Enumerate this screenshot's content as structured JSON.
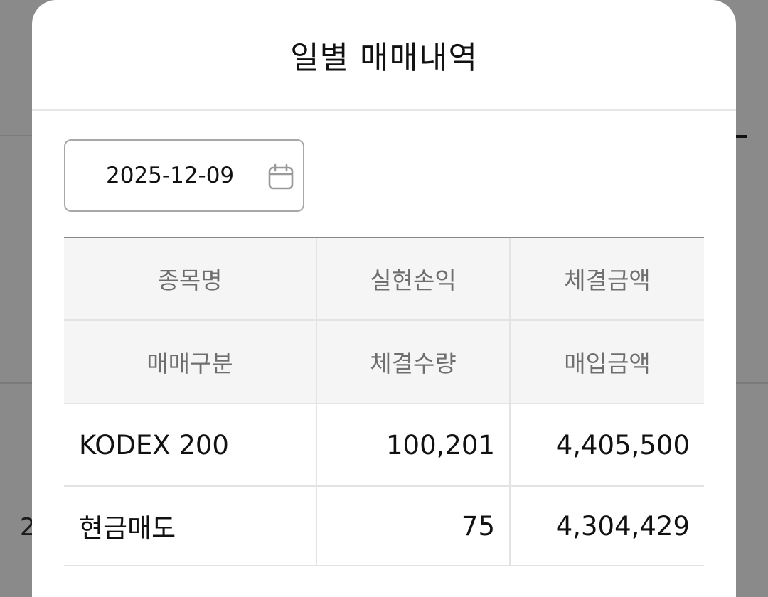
{
  "modal": {
    "title": "일별 매매내역"
  },
  "date_filter": {
    "value": "2025-12-09",
    "icon": "calendar-icon"
  },
  "table": {
    "headers_row1": [
      "종목명",
      "실현손익",
      "체결금액"
    ],
    "headers_row2": [
      "매매구분",
      "체결수량",
      "매입금액"
    ],
    "rows": [
      {
        "name": "KODEX 200",
        "realized_pnl": "100,201",
        "trade_amount": "4,405,500",
        "trade_type": "현금매도",
        "quantity": "75",
        "purchase_amount": "4,304,429"
      }
    ]
  },
  "colors": {
    "profit": "#c0393b",
    "backdrop": "#8a8a8a"
  },
  "background": {
    "partial_text": "2"
  }
}
